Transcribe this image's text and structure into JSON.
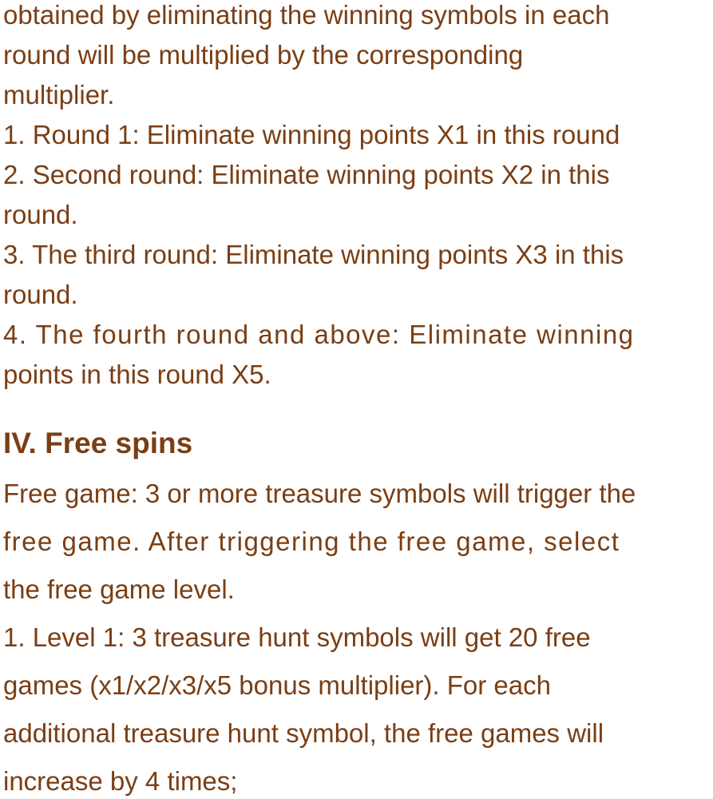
{
  "multiplier_section": {
    "lines": [
      "obtained by eliminating the winning symbols in each",
      "round will be multiplied by the corresponding",
      "multiplier.",
      "1. Round 1: Eliminate winning points X1 in this round",
      "2. Second round: Eliminate winning points X2 in this",
      "round.",
      "3. The third round: Eliminate winning points X3 in this",
      "round.",
      "4. The fourth round and above: Eliminate winning",
      "points in this round X5."
    ]
  },
  "free_spins_section": {
    "heading": "IV. Free spins",
    "lines": [
      "Free game: 3 or more treasure symbols will trigger the",
      "free game. After triggering the free game, select",
      "the free game level.",
      "1. Level 1: 3 treasure hunt symbols will get 20 free",
      "games (x1/x2/x3/x5 bonus multiplier). For each",
      "additional treasure hunt symbol, the free games will",
      "increase by 4 times;"
    ]
  },
  "colors": {
    "text": "#7a3e14",
    "background": "#ffffff"
  }
}
